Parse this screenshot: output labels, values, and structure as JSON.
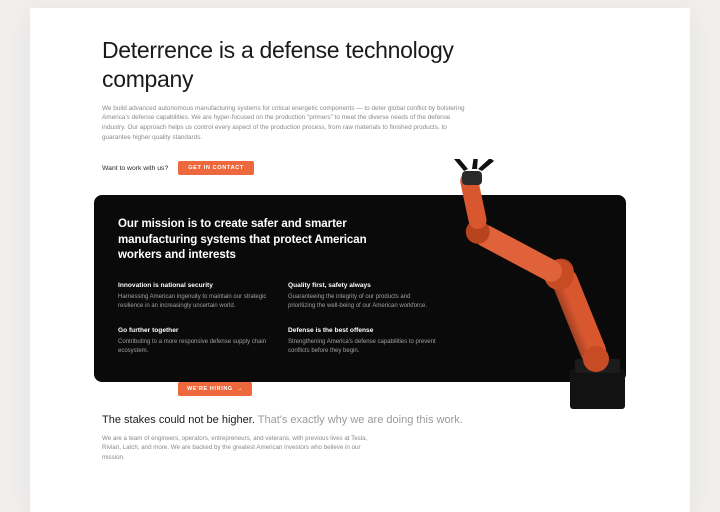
{
  "hero": {
    "title": "Deterrence is a defense technology company",
    "body": "We build advanced autonomous manufacturing systems for critical energetic components — to deter global conflict by bolstering America's defense capabilities. We are hyper-focused on the production \"primers\" to meet the diverse needs of the defense industry. Our approach helps us control every aspect of the production process, from raw materials to finished products, to guarantee higher quality standards.",
    "cta_label": "Want to work with us?",
    "cta_button": "Get in contact"
  },
  "mission": {
    "title": "Our mission is to create safer and smarter manufacturing systems that protect American workers and interests",
    "values": [
      {
        "title": "Innovation is national security",
        "body": "Harnessing American ingenuity to maintain our strategic resilience in an increasingly uncertain world."
      },
      {
        "title": "Quality first, safety always",
        "body": "Guaranteeing the integrity of our products and prioritizing the well-being of our American workforce."
      },
      {
        "title": "Go further together",
        "body": "Contributing to a more responsive defense supply chain ecosystem."
      },
      {
        "title": "Defense is the best offense",
        "body": "Strengthening America's defense capabilities to prevent conflicts before they begin."
      }
    ],
    "hiring_button": "We're hiring",
    "hiring_arrow": "→"
  },
  "stakes": {
    "strong": "The stakes could not be higher.",
    "muted": "That's exactly why we are doing this work.",
    "body": "We are a team of engineers, operators, entrepreneurs, and veterans, with previous lives at Tesla, Rivian, Latch, and more. We are backed by the greatest American investors who believe in our mission."
  },
  "colors": {
    "accent": "#ed683c",
    "robot": "#d9572f",
    "dark": "#0a0a0a"
  },
  "robot_icon": "industrial-robot-arm"
}
